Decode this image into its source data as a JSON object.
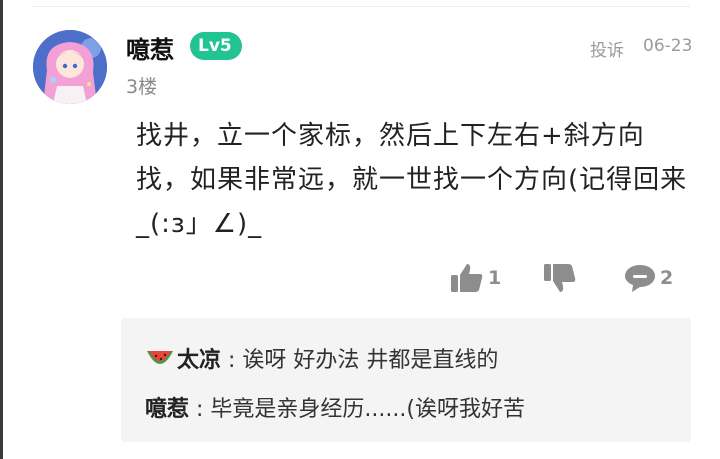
{
  "comment": {
    "username": "噫惹",
    "level": "Lv5",
    "floor": "3楼",
    "report_label": "投诉",
    "date": "06-23",
    "content": "找井，立一个家标，然后上下左右+斜方向找，如果非常远，就一世找一个方向(记得回来_(:з」∠)_",
    "actions": {
      "like_count": "1",
      "reply_count": "2",
      "like_icon": "thumbs-up-icon",
      "dislike_icon": "thumbs-down-icon",
      "reply_icon": "speech-bubble-icon"
    }
  },
  "replies": [
    {
      "name": "太凉",
      "separator": " : ",
      "text": "诶呀 好办法 井都是直线的",
      "icon": "watermelon-icon"
    },
    {
      "name": "噫惹",
      "separator": " : ",
      "text": "毕竟是亲身经历......(诶呀我好苦"
    }
  ],
  "colors": {
    "level_badge": "#22c491",
    "reply_bg": "#f4f4f4",
    "meta_text": "#9a9a9a"
  }
}
